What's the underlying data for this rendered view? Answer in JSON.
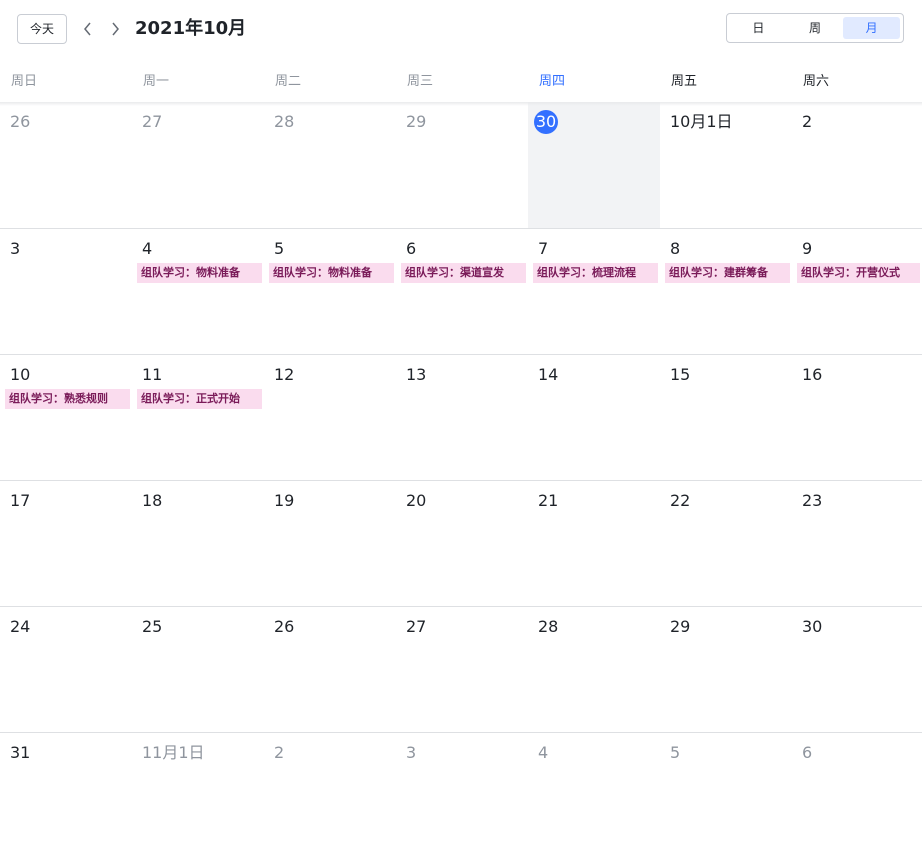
{
  "toolbar": {
    "today_label": "今天",
    "title": "2021年10月",
    "views": [
      {
        "label": "日",
        "active": false
      },
      {
        "label": "周",
        "active": false
      },
      {
        "label": "月",
        "active": true
      }
    ]
  },
  "weekdays": [
    "周日",
    "周一",
    "周二",
    "周三",
    "周四",
    "周五",
    "周六"
  ],
  "current_weekday_index": 4,
  "colors": {
    "accent": "#3370ff",
    "event_bg": "#fadcee",
    "event_text": "#7a1b59",
    "today_bg": "#f2f3f5"
  },
  "weeks": [
    [
      {
        "label": "26",
        "muted": true
      },
      {
        "label": "27",
        "muted": true
      },
      {
        "label": "28",
        "muted": true
      },
      {
        "label": "29",
        "muted": true
      },
      {
        "label": "30",
        "today": true
      },
      {
        "label": "10月1日"
      },
      {
        "label": "2"
      }
    ],
    [
      {
        "label": "3"
      },
      {
        "label": "4",
        "event": "组队学习：物料准备"
      },
      {
        "label": "5",
        "event": "组队学习：物料准备"
      },
      {
        "label": "6",
        "event": "组队学习：渠道宣发"
      },
      {
        "label": "7",
        "event": "组队学习：梳理流程"
      },
      {
        "label": "8",
        "event": "组队学习：建群筹备"
      },
      {
        "label": "9",
        "event": "组队学习：开营仪式"
      }
    ],
    [
      {
        "label": "10",
        "event": "组队学习：熟悉规则"
      },
      {
        "label": "11",
        "event": "组队学习：正式开始"
      },
      {
        "label": "12"
      },
      {
        "label": "13"
      },
      {
        "label": "14"
      },
      {
        "label": "15"
      },
      {
        "label": "16"
      }
    ],
    [
      {
        "label": "17"
      },
      {
        "label": "18"
      },
      {
        "label": "19"
      },
      {
        "label": "20"
      },
      {
        "label": "21"
      },
      {
        "label": "22"
      },
      {
        "label": "23"
      }
    ],
    [
      {
        "label": "24"
      },
      {
        "label": "25"
      },
      {
        "label": "26"
      },
      {
        "label": "27"
      },
      {
        "label": "28"
      },
      {
        "label": "29"
      },
      {
        "label": "30"
      }
    ],
    [
      {
        "label": "31"
      },
      {
        "label": "11月1日",
        "muted": true
      },
      {
        "label": "2",
        "muted": true
      },
      {
        "label": "3",
        "muted": true
      },
      {
        "label": "4",
        "muted": true
      },
      {
        "label": "5",
        "muted": true
      },
      {
        "label": "6",
        "muted": true
      }
    ]
  ]
}
